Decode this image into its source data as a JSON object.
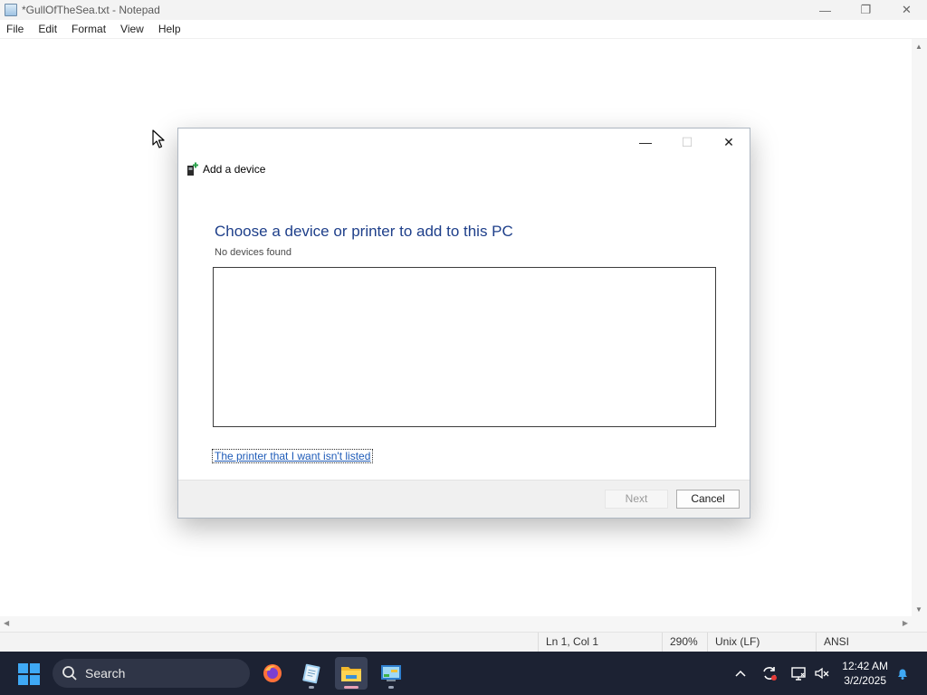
{
  "notepad": {
    "title": "*GullOfTheSea.txt - Notepad",
    "icon": "notepad-icon",
    "window_controls": {
      "minimize": "—",
      "restore": "❐",
      "close": "✕"
    },
    "menu": [
      "File",
      "Edit",
      "Format",
      "View",
      "Help"
    ],
    "status": {
      "position": "Ln 1, Col 1",
      "zoom": "290%",
      "line_endings": "Unix (LF)",
      "encoding": "ANSI"
    }
  },
  "dialog": {
    "title": "Add a device",
    "icon": "add-device-icon",
    "heading": "Choose a device or printer to add to this PC",
    "subtitle": "No devices found",
    "devices": [],
    "link": "The printer that I want isn't listed",
    "buttons": {
      "next": "Next",
      "cancel": "Cancel"
    },
    "window_controls": {
      "minimize": "—",
      "maximize": "☐",
      "close": "✕"
    },
    "heading_color": "#1e3f8a",
    "link_color": "#1e5bb8"
  },
  "taskbar": {
    "search_placeholder": "Search",
    "apps": [
      {
        "name": "firefox",
        "icon": "firefox-icon"
      },
      {
        "name": "notepad",
        "icon": "notepad-icon"
      },
      {
        "name": "file-explorer",
        "icon": "folder-icon",
        "active": true
      },
      {
        "name": "control-panel",
        "icon": "control-panel-icon"
      }
    ],
    "tray": {
      "chevron": "^",
      "time": "12:42 AM",
      "date": "3/2/2025"
    },
    "accent_color": "#3fa9f5",
    "background": "#1c2233"
  }
}
